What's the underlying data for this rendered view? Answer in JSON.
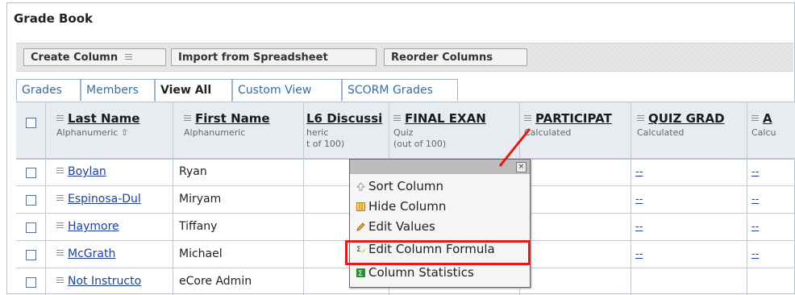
{
  "window": {
    "title": "Grade Book"
  },
  "toolbar": {
    "create_column": "Create Column",
    "import_spreadsheet": "Import from Spreadsheet",
    "reorder_columns": "Reorder Columns"
  },
  "tabs": [
    {
      "label": "Grades"
    },
    {
      "label": "Members"
    },
    {
      "label": "View All"
    },
    {
      "label": "Custom View"
    },
    {
      "label": "SCORM Grades"
    }
  ],
  "columns": {
    "last_name": {
      "label": "Last Name",
      "sub": "Alphanumeric ⇧"
    },
    "first_name": {
      "label": "First Name",
      "sub": "Alphanumeric"
    },
    "l6": {
      "label": "L6 Discussi",
      "sub1": "heric",
      "sub2": "t of 100)"
    },
    "final_exam": {
      "label": "FINAL EXAN",
      "sub1": "Quiz",
      "sub2": "(out of 100)"
    },
    "participation": {
      "label": "PARTICIPAT",
      "sub": "Calculated"
    },
    "quiz_grade": {
      "label": "QUIZ GRAD",
      "sub": "Calculated"
    },
    "a_col": {
      "label": "A",
      "sub": "Calcu"
    }
  },
  "rows": [
    {
      "last": "Boylan",
      "first": "Ryan"
    },
    {
      "last": "Espinosa-Dul",
      "first": "Miryam"
    },
    {
      "last": "Haymore",
      "first": "Tiffany"
    },
    {
      "last": "McGrath",
      "first": "Michael"
    },
    {
      "last": "Not Instructo",
      "first": "eCore Admin"
    }
  ],
  "cell_placeholder": "--",
  "popup_menu": {
    "close": "×",
    "items": [
      {
        "label": "Sort Column",
        "icon": "sort-icon"
      },
      {
        "label": "Hide Column",
        "icon": "hide-column-icon"
      },
      {
        "label": "Edit Values",
        "icon": "pencil-icon"
      },
      {
        "label": "Edit Column Formula",
        "icon": "formula-icon"
      },
      {
        "label": "Column Statistics",
        "icon": "statistics-icon"
      }
    ]
  },
  "colors": {
    "highlight": "#e01b1b",
    "link": "#1f3f9c",
    "tab": "#3a6b9e"
  }
}
